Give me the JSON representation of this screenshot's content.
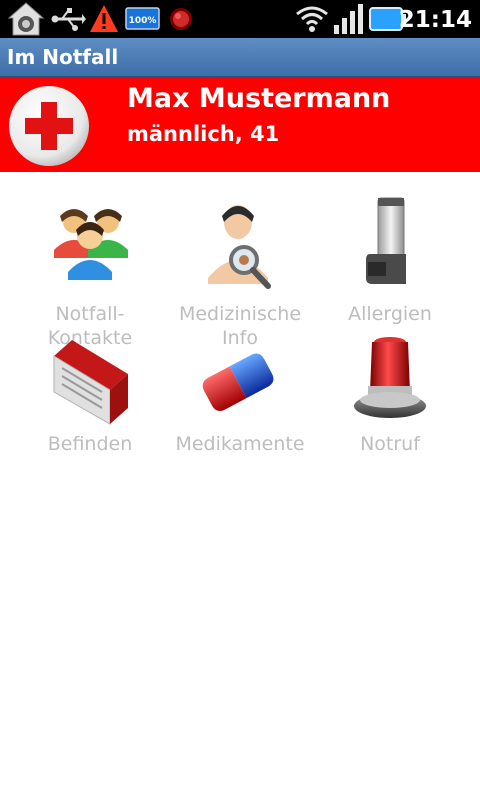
{
  "status_bar": {
    "time": "21:14",
    "battery_badge": "100%",
    "icons": [
      "home-icon",
      "usb-icon",
      "warning-icon",
      "battery-badge-icon",
      "record-icon",
      "wifi-icon",
      "signal-icon",
      "battery-icon"
    ]
  },
  "app": {
    "title": "Im Notfall"
  },
  "profile": {
    "name": "Max Mustermann",
    "info": "männlich, 41"
  },
  "tiles": [
    {
      "label": "Notfall-\nKontakte",
      "icon": "contacts-icon"
    },
    {
      "label": "Medizinische\nInfo",
      "icon": "doctor-icon"
    },
    {
      "label": "Allergien",
      "icon": "inhaler-icon"
    },
    {
      "label": "Befinden",
      "icon": "book-icon"
    },
    {
      "label": "Medikamente",
      "icon": "pill-icon"
    },
    {
      "label": "Notruf",
      "icon": "siren-icon"
    }
  ],
  "colors": {
    "header_red": "#ff0000",
    "title_blue": "#4a7bb5",
    "label_gray": "#bdbdbd"
  }
}
